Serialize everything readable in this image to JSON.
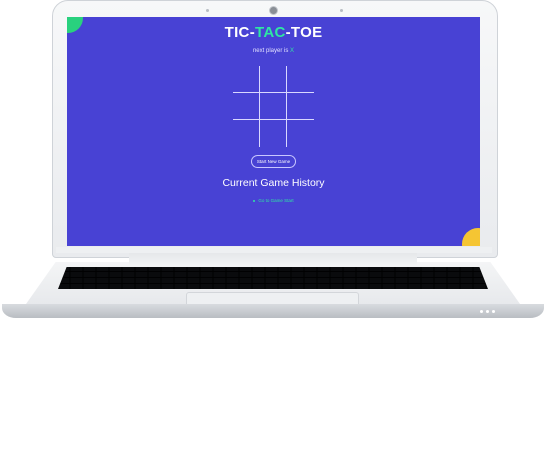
{
  "game": {
    "title_part1": "TIC-",
    "title_part2": "TAC",
    "title_part3": "-TOE",
    "next_player_prefix": "next player is ",
    "next_player_mark": "X",
    "board": [
      "",
      "",
      "",
      "",
      "",
      "",
      "",
      "",
      ""
    ],
    "new_game_label": "Start New Game",
    "history_title": "Current Game History",
    "history_items": [
      "Go to Game Start"
    ]
  },
  "colors": {
    "background": "#4842d4",
    "accent": "#2ee7a3",
    "corner_green": "#29d17e",
    "corner_yellow": "#f5c533"
  }
}
